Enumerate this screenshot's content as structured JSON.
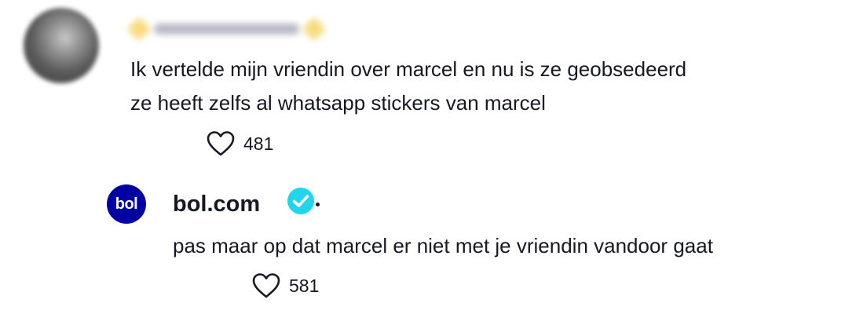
{
  "comment": {
    "lines": [
      "Ik vertelde mijn vriendin over marcel en nu is ze geobsedeerd",
      "ze heeft zelfs al whatsapp stickers van marcel"
    ],
    "likes": "481",
    "icon": "heart-outline-icon"
  },
  "reply": {
    "avatar_text": "bol",
    "author": "bol.com",
    "verified_icon": "verified-badge-icon",
    "verified_color": "#20d5ec",
    "brand_color": "#0000a4",
    "text": "pas maar op dat marcel er niet met je vriendin vandoor gaat",
    "likes": "581",
    "icon": "heart-outline-icon"
  }
}
